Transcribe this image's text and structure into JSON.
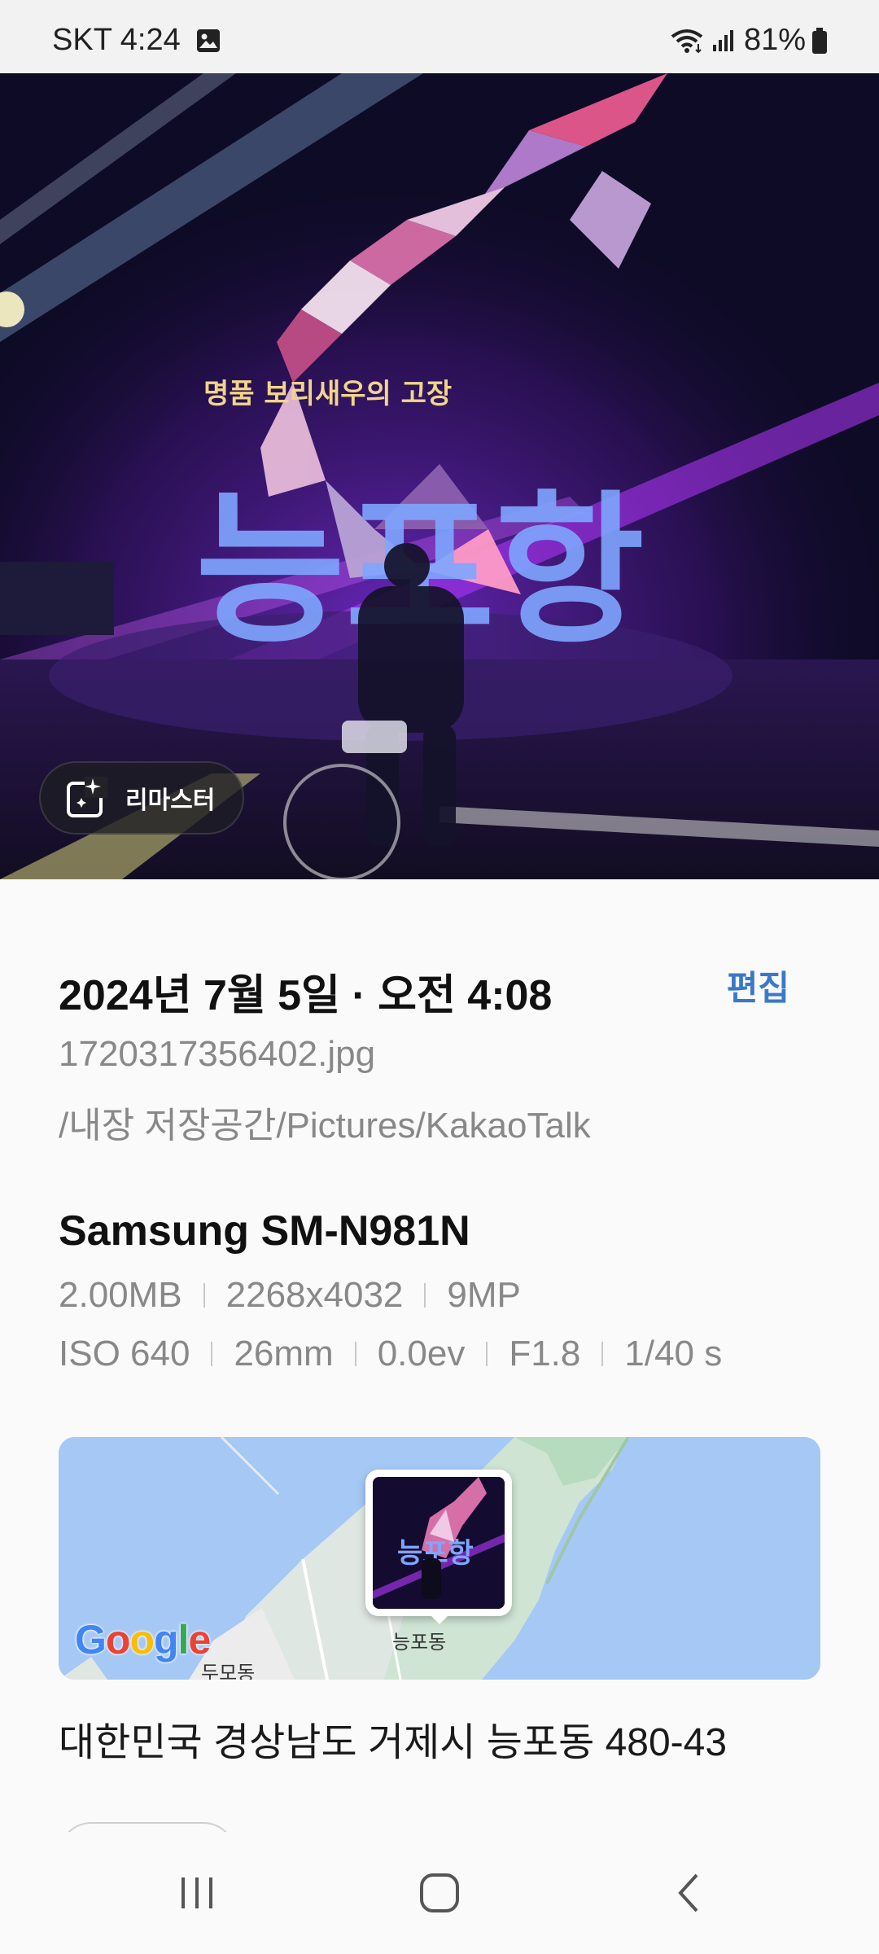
{
  "status_bar": {
    "carrier_time": "SKT 4:24",
    "battery": "81%",
    "icons": [
      "gallery-icon",
      "wifi-icon",
      "signal-icon",
      "battery-icon"
    ]
  },
  "photo": {
    "sign_small_text": "명품 보리새우의 고장",
    "sign_big_text": "능포항",
    "remaster_label": "리마스터"
  },
  "details": {
    "datetime": "2024년 7월 5일 · 오전 4:08",
    "edit_label": "편집",
    "filename": "1720317356402.jpg",
    "path": "/내장 저장공간/Pictures/KakaoTalk",
    "device": "Samsung SM-N981N",
    "size": "2.00MB",
    "resolution": "2268x4032",
    "megapixels": "9MP",
    "iso": "ISO 640",
    "focal_length": "26mm",
    "exposure_value": "0.0ev",
    "aperture": "F1.8",
    "shutter": "1/40 s"
  },
  "map": {
    "pin_label": "능포동",
    "area_label": "두모동",
    "logo_letters": [
      "G",
      "o",
      "o",
      "g",
      "l",
      "e"
    ],
    "logo_colors": [
      "#4285F4",
      "#EA4335",
      "#FBBC05",
      "#4285F4",
      "#34A853",
      "#EA4335"
    ]
  },
  "address": "대한민국 경상남도 거제시 능포동 480-43",
  "nav": {
    "icons": [
      "recent-apps-icon",
      "home-icon",
      "back-icon"
    ]
  }
}
